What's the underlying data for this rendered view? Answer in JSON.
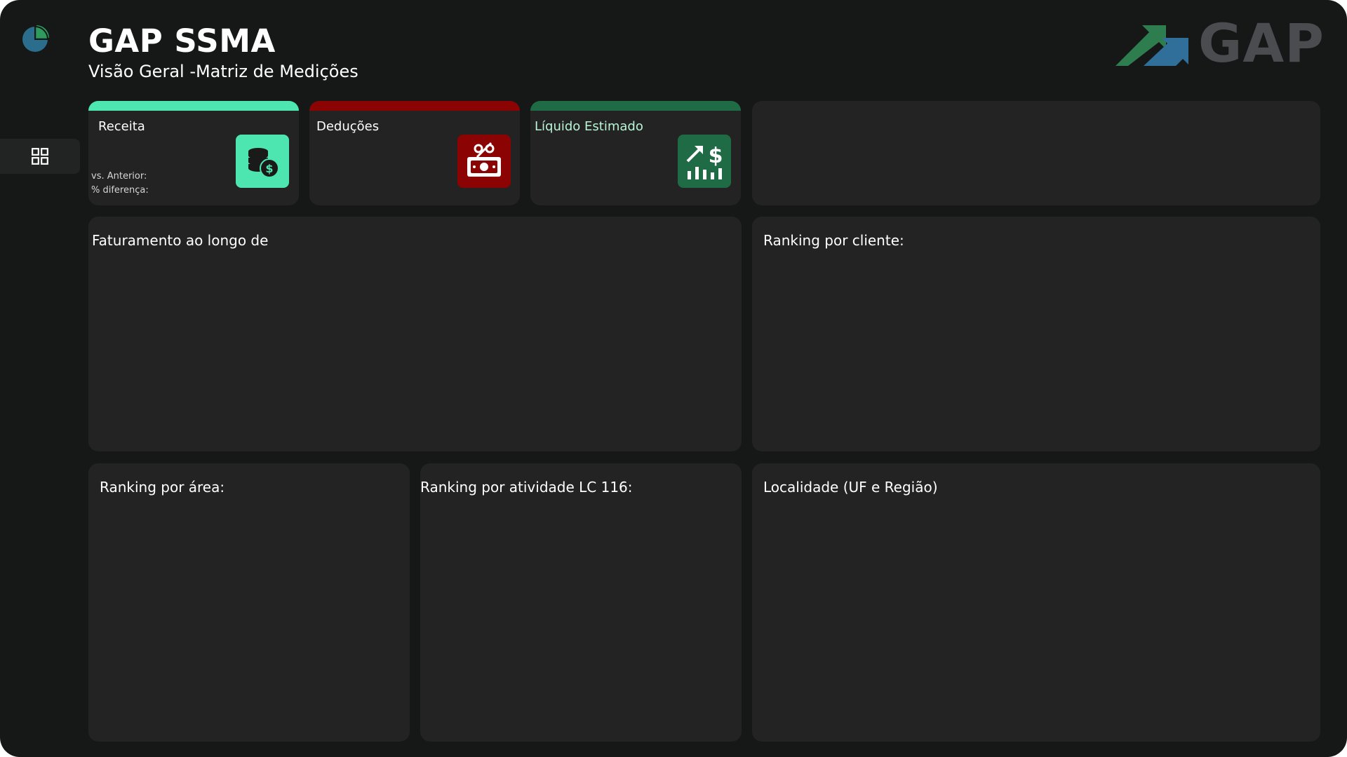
{
  "header": {
    "title": "GAP SSMA",
    "subtitle": "Visão Geral -Matriz de Medições",
    "brand": "GAP"
  },
  "sidebar": {
    "logo_icon": "pie-chart-icon",
    "items": [
      {
        "icon": "grid-icon",
        "active": true
      }
    ]
  },
  "kpis": [
    {
      "label": "Receita",
      "accent": "#4ee6b0",
      "icon": "coins-dollar-icon",
      "vs_label": "vs.  Anterior:",
      "diff_label": "% diferença:"
    },
    {
      "label": "Deduções",
      "accent": "#8c0303",
      "icon": "discount-ticket-icon"
    },
    {
      "label": "Líquido Estimado",
      "accent": "#1f6b45",
      "label_color": "#b9f5d6",
      "icon": "chart-dollar-up-icon"
    }
  ],
  "panels": {
    "faturamento": "Faturamento ao longo de",
    "ranking_cliente": "Ranking  por cliente:",
    "ranking_area": "Ranking  por área:",
    "ranking_atividade": "Ranking por atividade LC 116:",
    "localidade": "Localidade (UF e Região)"
  },
  "colors": {
    "background": "#161717",
    "card": "#232323",
    "brand_green": "#2e7d4f",
    "brand_blue": "#2f6f9a",
    "brand_gray": "#4a4c4f"
  }
}
